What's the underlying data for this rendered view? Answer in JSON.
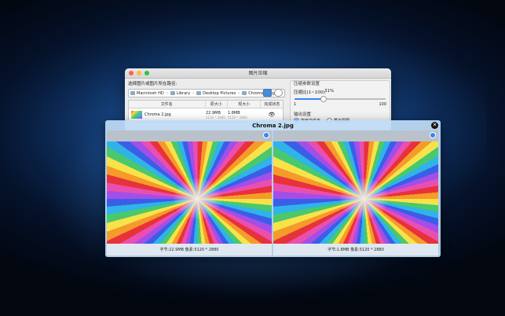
{
  "window": {
    "title": "图片压缩",
    "path_label": "选择图片或图片所在路径:",
    "breadcrumbs": [
      "Macintosh HD",
      "Library",
      "Desktop Pictures",
      "Chroma 2.jpg"
    ],
    "columns": [
      "文件名",
      "原大小",
      "现大小",
      "完成状态"
    ],
    "row": {
      "name": "Chroma 2.jpg",
      "orig_size": "22.9MB",
      "orig_dims": "5120 * 2880",
      "new_size": "1.8MB",
      "new_dims": "5120 * 2880"
    }
  },
  "settings": {
    "section_title": "压缩参数设置",
    "ratio_label": "压缩比(1~100):",
    "ratio_value": "31%",
    "ratio_fraction": 0.31,
    "min": "1",
    "max": "100",
    "output_title": "输出设置",
    "radio_folder": "指定文件夹",
    "radio_overwrite": "覆盖原图"
  },
  "preview": {
    "title": "Chroma 2.jpg",
    "left_caption": "字节:22.9MB  像素:5120 * 2880",
    "right_caption": "字节:1.8MB  像素:5120 * 2880"
  }
}
